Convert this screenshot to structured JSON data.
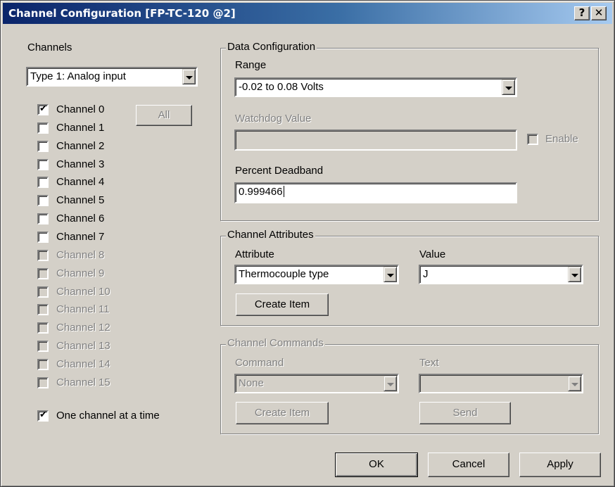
{
  "window": {
    "title": "Channel Configuration [FP-TC-120 @2]",
    "help_label": "?",
    "close_label": "✕"
  },
  "channels": {
    "heading": "Channels",
    "type_select": "Type 1: Analog input",
    "all_button": "All",
    "items": [
      {
        "label": "Channel 0",
        "checked": true,
        "enabled": true
      },
      {
        "label": "Channel 1",
        "checked": false,
        "enabled": true
      },
      {
        "label": "Channel 2",
        "checked": false,
        "enabled": true
      },
      {
        "label": "Channel 3",
        "checked": false,
        "enabled": true
      },
      {
        "label": "Channel 4",
        "checked": false,
        "enabled": true
      },
      {
        "label": "Channel 5",
        "checked": false,
        "enabled": true
      },
      {
        "label": "Channel 6",
        "checked": false,
        "enabled": true
      },
      {
        "label": "Channel 7",
        "checked": false,
        "enabled": true
      },
      {
        "label": "Channel 8",
        "checked": false,
        "enabled": false
      },
      {
        "label": "Channel 9",
        "checked": false,
        "enabled": false
      },
      {
        "label": "Channel 10",
        "checked": false,
        "enabled": false
      },
      {
        "label": "Channel 11",
        "checked": false,
        "enabled": false
      },
      {
        "label": "Channel 12",
        "checked": false,
        "enabled": false
      },
      {
        "label": "Channel 13",
        "checked": false,
        "enabled": false
      },
      {
        "label": "Channel 14",
        "checked": false,
        "enabled": false
      },
      {
        "label": "Channel 15",
        "checked": false,
        "enabled": false
      }
    ],
    "one_at_a_time": {
      "label": "One channel at a time",
      "checked": true
    }
  },
  "data_config": {
    "title": "Data Configuration",
    "range_label": "Range",
    "range_value": "-0.02 to 0.08 Volts",
    "watchdog_label": "Watchdog Value",
    "watchdog_value": "",
    "enable_label": "Enable",
    "deadband_label": "Percent Deadband",
    "deadband_value": "0.999466"
  },
  "attributes": {
    "title": "Channel Attributes",
    "attribute_label": "Attribute",
    "attribute_value": "Thermocouple type",
    "value_label": "Value",
    "value_value": "J",
    "create_button": "Create Item"
  },
  "commands": {
    "title": "Channel Commands",
    "command_label": "Command",
    "command_value": "None",
    "text_label": "Text",
    "text_value": "",
    "create_button": "Create Item",
    "send_button": "Send"
  },
  "footer": {
    "ok": "OK",
    "cancel": "Cancel",
    "apply": "Apply"
  },
  "check_glyph": "✔"
}
